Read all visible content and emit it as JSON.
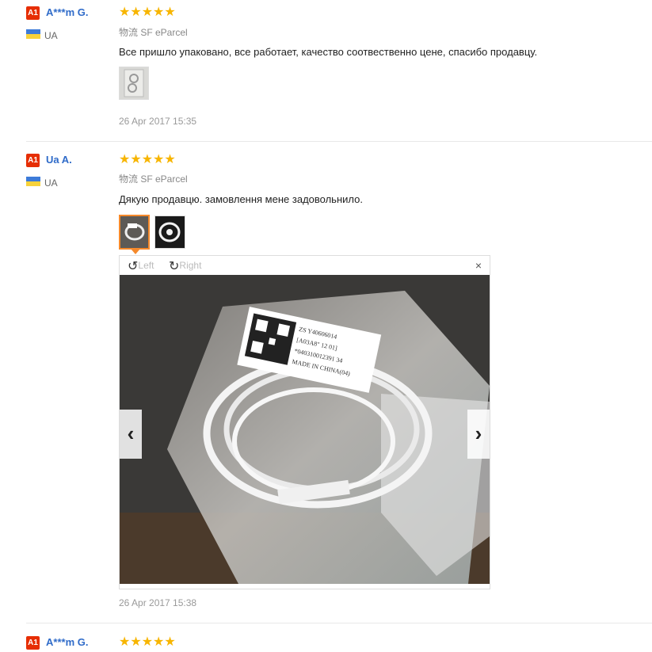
{
  "reviews": [
    {
      "badge": "A1",
      "name": "A***m G.",
      "country": "UA",
      "stars": "★★★★★",
      "shipping": "物流 SF eParcel",
      "text": "Все пришло упаковано, все работает, качество соотвественно цене, спасибо продавцу.",
      "date": "26 Apr 2017 15:35"
    },
    {
      "badge": "A1",
      "name": "Ua A.",
      "country": "UA",
      "stars": "★★★★★",
      "shipping": "物流 SF eParcel",
      "text": "Дякую продавцю. замовлення мене задовольнило.",
      "date": "26 Apr 2017 15:38"
    },
    {
      "badge": "A1",
      "name": "A***m G.",
      "stars": "★★★★★"
    }
  ],
  "viewer": {
    "rotate_left": "Left",
    "rotate_right": "Right",
    "close": "×",
    "prev": "‹",
    "next": "›",
    "label_lines": [
      "ZS Y40606014",
      "[A03A8\" 12 01]",
      "*040310012391 34",
      "MADE IN CHINA(04)"
    ]
  },
  "colors": {
    "accent": "#e62e04",
    "name": "#2f6bc9",
    "star": "#f7b500",
    "selected_thumb": "#f5892b"
  }
}
